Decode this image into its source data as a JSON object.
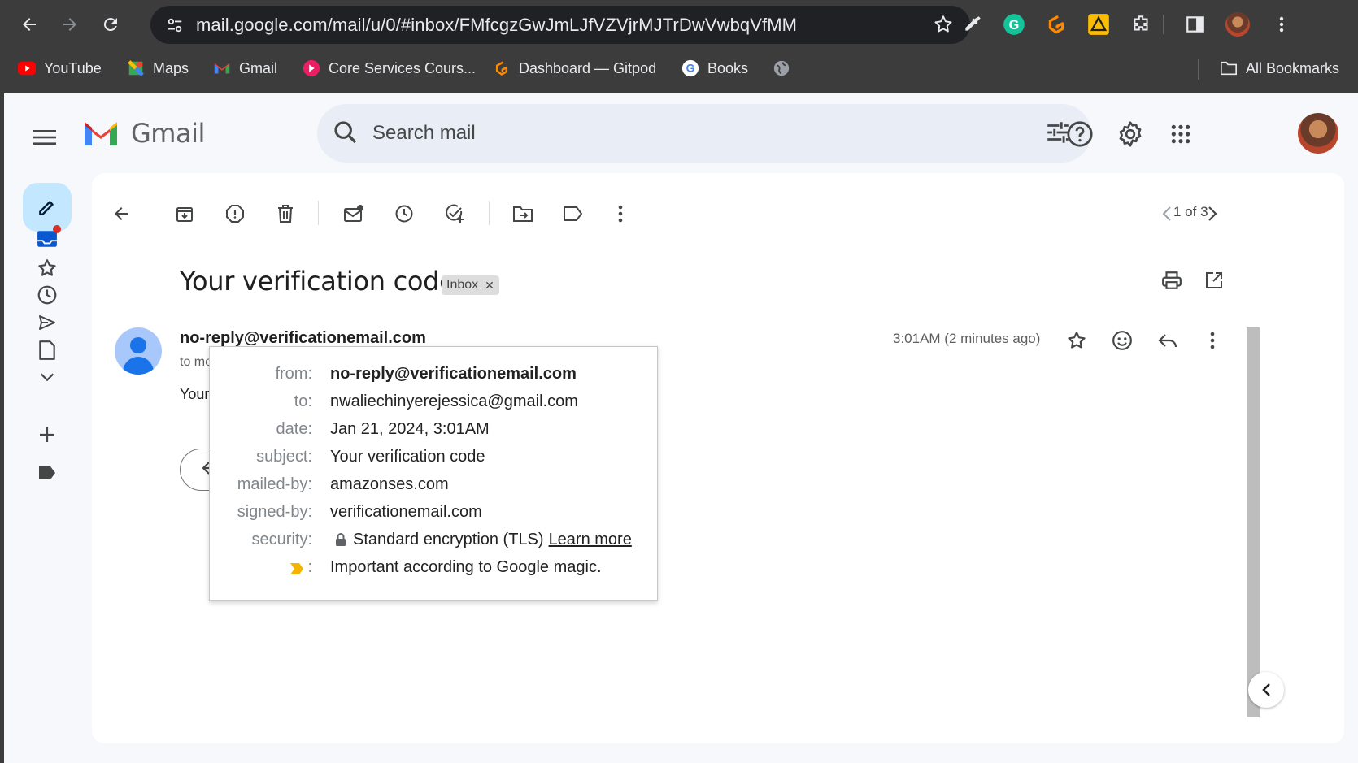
{
  "browser": {
    "url": "mail.google.com/mail/u/0/#inbox/FMfcgzGwJmLJfVZVjrMJTrDwVwbqVfMM",
    "bookmarks": [
      {
        "label": "YouTube",
        "icon": "youtube-icon"
      },
      {
        "label": "Maps",
        "icon": "maps-icon"
      },
      {
        "label": "Gmail",
        "icon": "gmail-icon"
      },
      {
        "label": "Core Services Cours...",
        "icon": "core-services-icon"
      },
      {
        "label": "Dashboard — Gitpod",
        "icon": "gitpod-icon"
      },
      {
        "label": "Books",
        "icon": "google-icon"
      },
      {
        "label": "",
        "icon": "globe-icon"
      }
    ],
    "all_bookmarks": "All Bookmarks"
  },
  "gmail": {
    "logo_text": "Gmail",
    "search_placeholder": "Search mail"
  },
  "toolbar": {
    "pager": "1 of 3"
  },
  "message": {
    "subject": "Your verification code",
    "label_chip": "Inbox",
    "sender": "no-reply@verificationemail.com",
    "to_line": "to me",
    "time": "3:01AM (2 minutes ago)",
    "body_preview": "Your c"
  },
  "details": {
    "from_label": "from:",
    "from": "no-reply@verificationemail.com",
    "to_label": "to:",
    "to": "nwaliechinyerejessica@gmail.com",
    "date_label": "date:",
    "date": "Jan 21, 2024, 3:01AM",
    "subject_label": "subject:",
    "subject": "Your verification code",
    "mailed_by_label": "mailed-by:",
    "mailed_by": "amazonses.com",
    "signed_by_label": "signed-by:",
    "signed_by": "verificationemail.com",
    "security_label": "security:",
    "security": "Standard encryption (TLS)",
    "learn_more": "Learn more",
    "importance_colon": ":",
    "importance": "Important according to Google magic."
  },
  "colors": {
    "browser_frame": "#3c3c3c",
    "gmail_bg": "#f6f8fc",
    "compose_bg": "#c2e7ff",
    "importance_marker": "#f4b400"
  }
}
